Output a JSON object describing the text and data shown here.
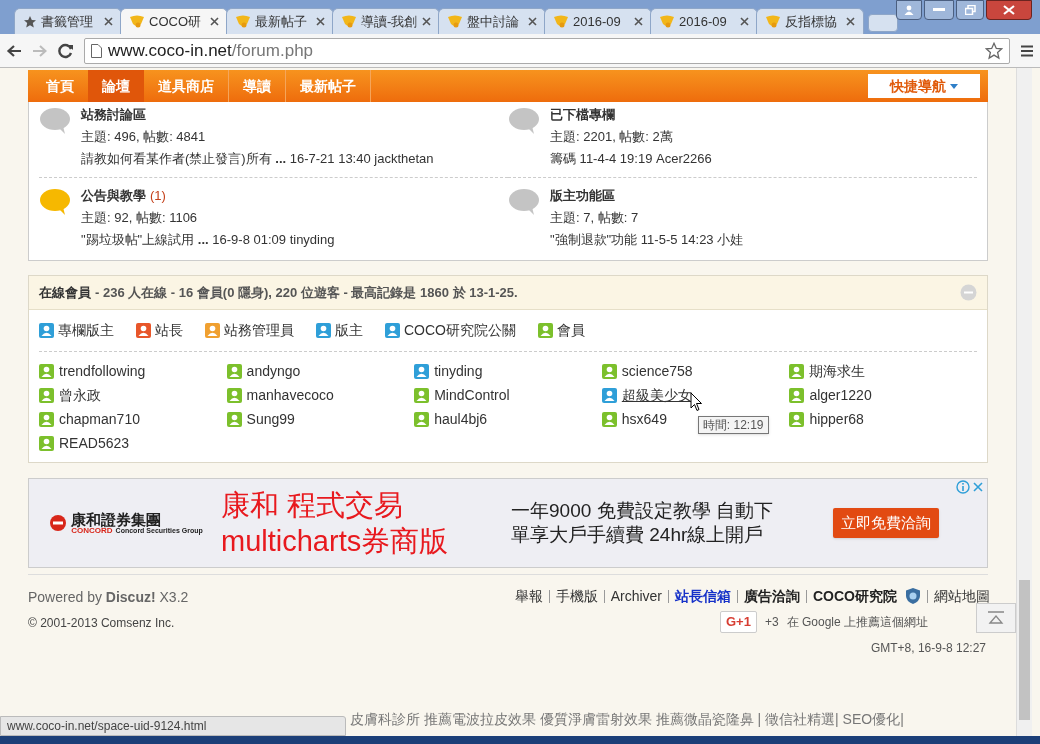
{
  "browser": {
    "tabs": [
      {
        "title": "書籤管理",
        "kind": "bookmarks",
        "selected": false
      },
      {
        "title": "COCO研",
        "kind": "site",
        "selected": true
      },
      {
        "title": "最新帖子",
        "kind": "site",
        "selected": false
      },
      {
        "title": "導讀-我創",
        "kind": "site",
        "selected": false
      },
      {
        "title": "盤中討論",
        "kind": "site",
        "selected": false
      },
      {
        "title": "2016-09",
        "kind": "site",
        "selected": false
      },
      {
        "title": "2016-09",
        "kind": "site",
        "selected": false
      },
      {
        "title": "反指標協",
        "kind": "site",
        "selected": false
      }
    ],
    "url_host": "www.coco-in.net",
    "url_path": "/forum.php"
  },
  "nav": {
    "items": [
      {
        "label": "首頁",
        "selected": false
      },
      {
        "label": "論壇",
        "selected": true
      },
      {
        "label": "道具商店",
        "selected": false
      },
      {
        "label": "導讀",
        "selected": false
      },
      {
        "label": "最新帖子",
        "selected": false
      }
    ],
    "quick_nav": "快捷導航"
  },
  "forums": [
    {
      "name": "站務討論區",
      "new": false,
      "stats": "主題: 496, 帖數: 4841",
      "last_post": "請教如何看某作者(禁止發言)所有 **...** 16-7-21 13:40 jackthetan"
    },
    {
      "name": "已下檔專欄",
      "new": false,
      "stats": "主題: 2201, 帖數: 2萬",
      "last_post": "籌碼 11-4-4 19:19 Acer2266"
    },
    {
      "name": "公告與教學",
      "new": true,
      "new_count": "(1)",
      "stats": "主題: 92, 帖數: 1106",
      "last_post": "\"踢垃圾帖\"上線試用 **...** 16-9-8 01:09 tinyding"
    },
    {
      "name": "版主功能區",
      "new": false,
      "stats": "主題: 7, 帖數: 7",
      "last_post": "\"強制退款\"功能 11-5-5 14:23 小娃"
    }
  ],
  "online": {
    "title": "在線會員",
    "summary": "- 236 人在線 - 16 會員(0 隱身), 220 位遊客 - 最高記錄是 1860 於 13-1-25.",
    "legend": [
      {
        "label": "專欄版主",
        "color": "#2f9fd8"
      },
      {
        "label": "站長",
        "color": "#e8562a"
      },
      {
        "label": "站務管理員",
        "color": "#f0a030"
      },
      {
        "label": "版主",
        "color": "#2f9fd8"
      },
      {
        "label": "COCO研究院公關",
        "color": "#2f9fd8"
      },
      {
        "label": "會員",
        "color": "#7cc02c"
      }
    ],
    "members": [
      {
        "name": "trendfollowing",
        "color": "#7cc02c",
        "hovered": false
      },
      {
        "name": "andyngo",
        "color": "#7cc02c",
        "hovered": false
      },
      {
        "name": "tinyding",
        "color": "#2f9fd8",
        "hovered": false
      },
      {
        "name": "science758",
        "color": "#7cc02c",
        "hovered": false
      },
      {
        "name": "期海求生",
        "color": "#7cc02c",
        "hovered": false
      },
      {
        "name": "曾永政",
        "color": "#7cc02c",
        "hovered": false
      },
      {
        "name": "manhavecoco",
        "color": "#7cc02c",
        "hovered": false
      },
      {
        "name": "MindControl",
        "color": "#7cc02c",
        "hovered": false
      },
      {
        "name": "超級美少女",
        "color": "#2f9fd8",
        "hovered": true
      },
      {
        "name": "alger1220",
        "color": "#7cc02c",
        "hovered": false
      },
      {
        "name": "chapman710",
        "color": "#7cc02c",
        "hovered": false
      },
      {
        "name": "Sung99",
        "color": "#7cc02c",
        "hovered": false
      },
      {
        "name": "haul4bj6",
        "color": "#7cc02c",
        "hovered": false
      },
      {
        "name": "hsx649",
        "color": "#7cc02c",
        "hovered": false
      },
      {
        "name": "hipper68",
        "color": "#7cc02c",
        "hovered": false
      },
      {
        "name": "READ5623",
        "color": "#7cc02c",
        "hovered": false
      }
    ],
    "tooltip": "時間: 12:19"
  },
  "ad": {
    "brand": "康和證券集團",
    "brand_mark": "CONCORD",
    "brand_sub": "Concord Securities Group",
    "headline_1": "康和 程式交易",
    "headline_2": "multicharts券商版",
    "body": "一年9000 免費設定教學 自動下單享大戶手續費 24hr線上開戶",
    "button": "立即免費洽詢"
  },
  "footer": {
    "powered": "Powered by **Discuz!** X3.2",
    "copyright": "© 2001-2013 Comsenz Inc.",
    "links": [
      {
        "label": "舉報",
        "kind": "normal"
      },
      {
        "label": "手機版",
        "kind": "normal"
      },
      {
        "label": "Archiver",
        "kind": "normal"
      },
      {
        "label": "站長信箱",
        "kind": "blue"
      },
      {
        "label": "廣告洽詢",
        "kind": "bold"
      },
      {
        "label": "COCO研究院",
        "kind": "bold",
        "shield": true
      },
      {
        "label": "網站地圖",
        "kind": "normal"
      }
    ],
    "gplus": "G+1",
    "gplus_count": "+3",
    "gplus_text": "在 Google 上推薦這個網址",
    "time": "GMT+8, 16-9-8 12:27"
  },
  "bottom_links": "皮膚科診所 推薦電波拉皮效果 優質淨膚雷射效果 推薦微晶瓷隆鼻 | 徵信社精選| SEO優化|",
  "status_url": "www.coco-in.net/space-uid-9124.html"
}
